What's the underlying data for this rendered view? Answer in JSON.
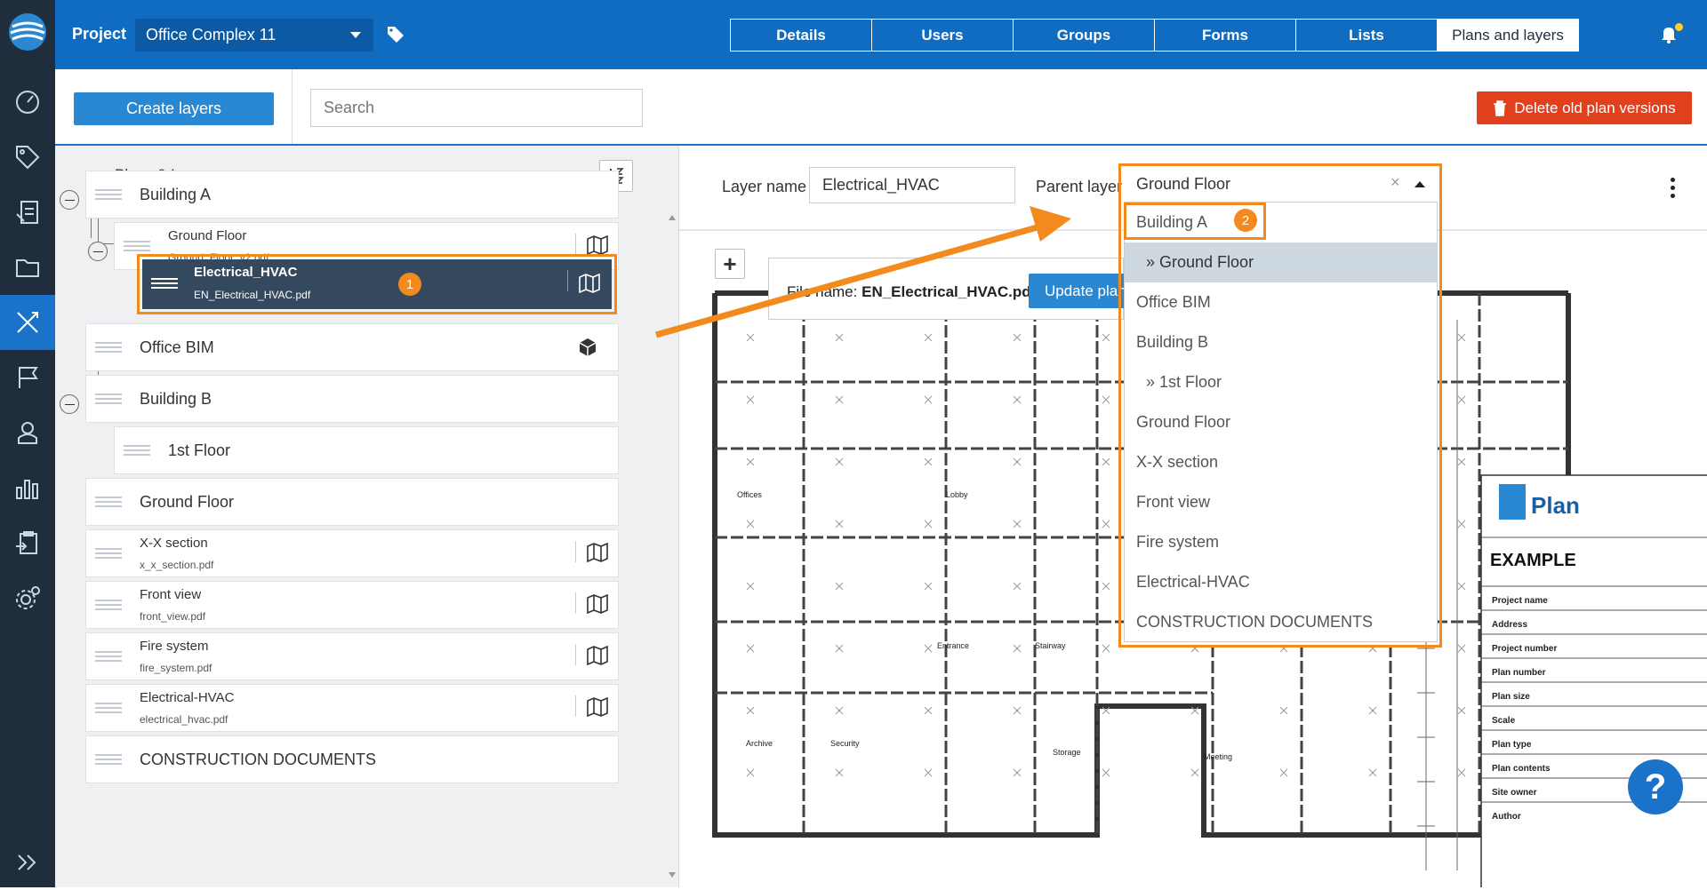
{
  "topbar": {
    "project_label": "Project",
    "project_value": "Office Complex 11",
    "tabs": [
      "Details",
      "Users",
      "Groups",
      "Forms",
      "Lists",
      "Plans and layers"
    ]
  },
  "toolbar": {
    "create_label": "Create layers",
    "search_placeholder": "Search",
    "delete_label": "Delete old plan versions"
  },
  "tree": {
    "title": "Plans & Layers",
    "nodes": [
      {
        "name": "Building A"
      },
      {
        "name": "Ground Floor",
        "file": "Ground_Floor_v2.pdf"
      },
      {
        "name": "Electrical_HVAC",
        "file": "EN_Electrical_HVAC.pdf"
      },
      {
        "name": "Office BIM"
      },
      {
        "name": "Building B"
      },
      {
        "name": "1st Floor"
      },
      {
        "name": "Ground Floor"
      },
      {
        "name": "X-X section",
        "file": "x_x_section.pdf"
      },
      {
        "name": "Front view",
        "file": "front_view.pdf"
      },
      {
        "name": "Fire system",
        "file": "fire_system.pdf"
      },
      {
        "name": "Electrical-HVAC",
        "file": "electrical_hvac.pdf"
      },
      {
        "name": "CONSTRUCTION DOCUMENTS"
      }
    ]
  },
  "editor": {
    "layer_name_label": "Layer name",
    "layer_name_value": "Electrical_HVAC",
    "parent_layer_label": "Parent layer",
    "parent_layer_value": "Ground Floor",
    "clear_symbol": "×",
    "file_name_label": "File name:",
    "file_name_value": "EN_Electrical_HVAC.pdf",
    "update_label": "Update plan"
  },
  "dropdown": {
    "options": [
      "Building A",
      "» Ground Floor",
      "Office BIM",
      "Building B",
      "» 1st Floor",
      "Ground Floor",
      "X-X section",
      "Front view",
      "Fire system",
      "Electrical-HVAC",
      "CONSTRUCTION DOCUMENTS"
    ]
  },
  "callouts": {
    "one": "1",
    "two": "2"
  },
  "plan": {
    "rooms": [
      "Offices",
      "Offices",
      "Lobby",
      "Entrance",
      "Stairway",
      "Archive",
      "Security",
      "Storage",
      "Meeting"
    ],
    "title_block": {
      "logo_text": "Plan",
      "example": "EXAMPLE",
      "rows": [
        "Project name",
        "Address",
        "Project number",
        "Plan number",
        "Plan size",
        "Scale",
        "Plan type",
        "Plan contents",
        "Site owner",
        "Author"
      ]
    }
  },
  "help_label": "?",
  "colors": {
    "brand": "#0f6cc0",
    "rail": "#1f2d3d",
    "accent": "#f28a1e",
    "danger": "#e2401c",
    "selected": "#34495e"
  }
}
